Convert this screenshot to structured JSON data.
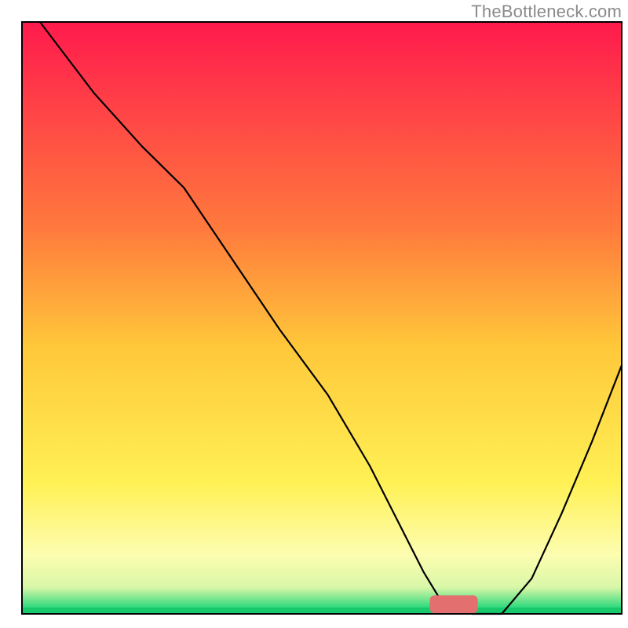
{
  "watermark": "TheBottleneck.com",
  "chart_data": {
    "type": "line",
    "title": "",
    "xlabel": "",
    "ylabel": "",
    "xlim": [
      0,
      100
    ],
    "ylim": [
      0,
      100
    ],
    "grid": false,
    "legend": false,
    "background_gradient": {
      "stops": [
        {
          "pos": 0.0,
          "color": "#ff1a4d"
        },
        {
          "pos": 0.35,
          "color": "#ff7a3d"
        },
        {
          "pos": 0.55,
          "color": "#ffc83a"
        },
        {
          "pos": 0.78,
          "color": "#fff155"
        },
        {
          "pos": 0.9,
          "color": "#fdfdb0"
        },
        {
          "pos": 0.955,
          "color": "#d9f7a8"
        },
        {
          "pos": 0.99,
          "color": "#2bd97c"
        }
      ],
      "direction": "vertical"
    },
    "series": [
      {
        "name": "bottleneck-curve",
        "stroke": "#000000",
        "stroke_width": 2.2,
        "x": [
          3,
          12,
          20,
          27,
          35,
          43,
          51,
          58,
          63,
          67,
          70,
          75,
          80,
          85,
          90,
          95,
          100
        ],
        "y": [
          100,
          88,
          79,
          72,
          60,
          48,
          37,
          25,
          15,
          7,
          2,
          0,
          0,
          6,
          17,
          29,
          42
        ]
      }
    ],
    "marker": {
      "name": "optimal-range-marker",
      "x_center": 72,
      "width": 8,
      "color": "#e36f6f",
      "height": 2.2
    },
    "frame": {
      "visible": true,
      "stroke": "#000000",
      "stroke_width": 2
    }
  }
}
